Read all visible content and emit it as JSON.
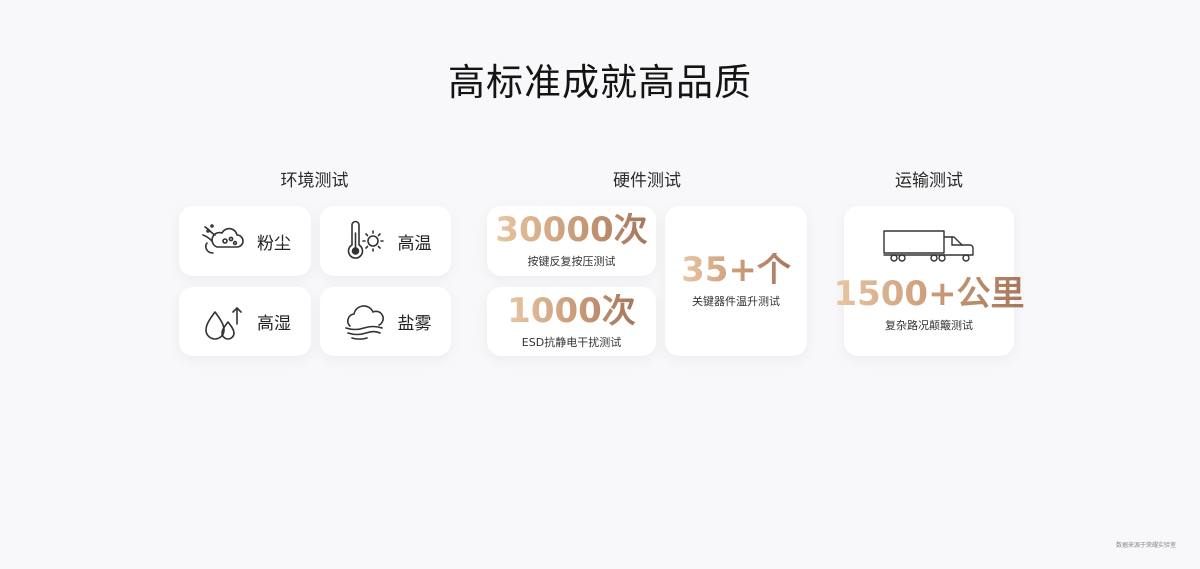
{
  "title": "高标准成就高品质",
  "groups": {
    "environment": {
      "title": "环境测试",
      "items": [
        {
          "label": "粉尘",
          "icon": "dust-cloud-icon"
        },
        {
          "label": "高温",
          "icon": "thermometer-sun-icon"
        },
        {
          "label": "高湿",
          "icon": "water-drops-icon"
        },
        {
          "label": "盐雾",
          "icon": "fog-cloud-icon"
        }
      ]
    },
    "hardware": {
      "title": "硬件测试",
      "items": [
        {
          "value": "30000次",
          "desc": "按键反复按压测试"
        },
        {
          "value": "1000次",
          "desc": "ESD抗静电干扰测试"
        },
        {
          "value": "35+个",
          "desc": "关键器件温升测试"
        }
      ]
    },
    "transport": {
      "title": "运输测试",
      "value": "1500+公里",
      "desc": "复杂路况颠簸测试",
      "icon": "truck-icon"
    }
  },
  "footnote": "数据来源于荣耀实验室",
  "colors": {
    "gold_gradient_start": "#e9c6a2",
    "gold_gradient_end": "#a5765c",
    "background": "#f8f8fa",
    "card": "#ffffff"
  }
}
